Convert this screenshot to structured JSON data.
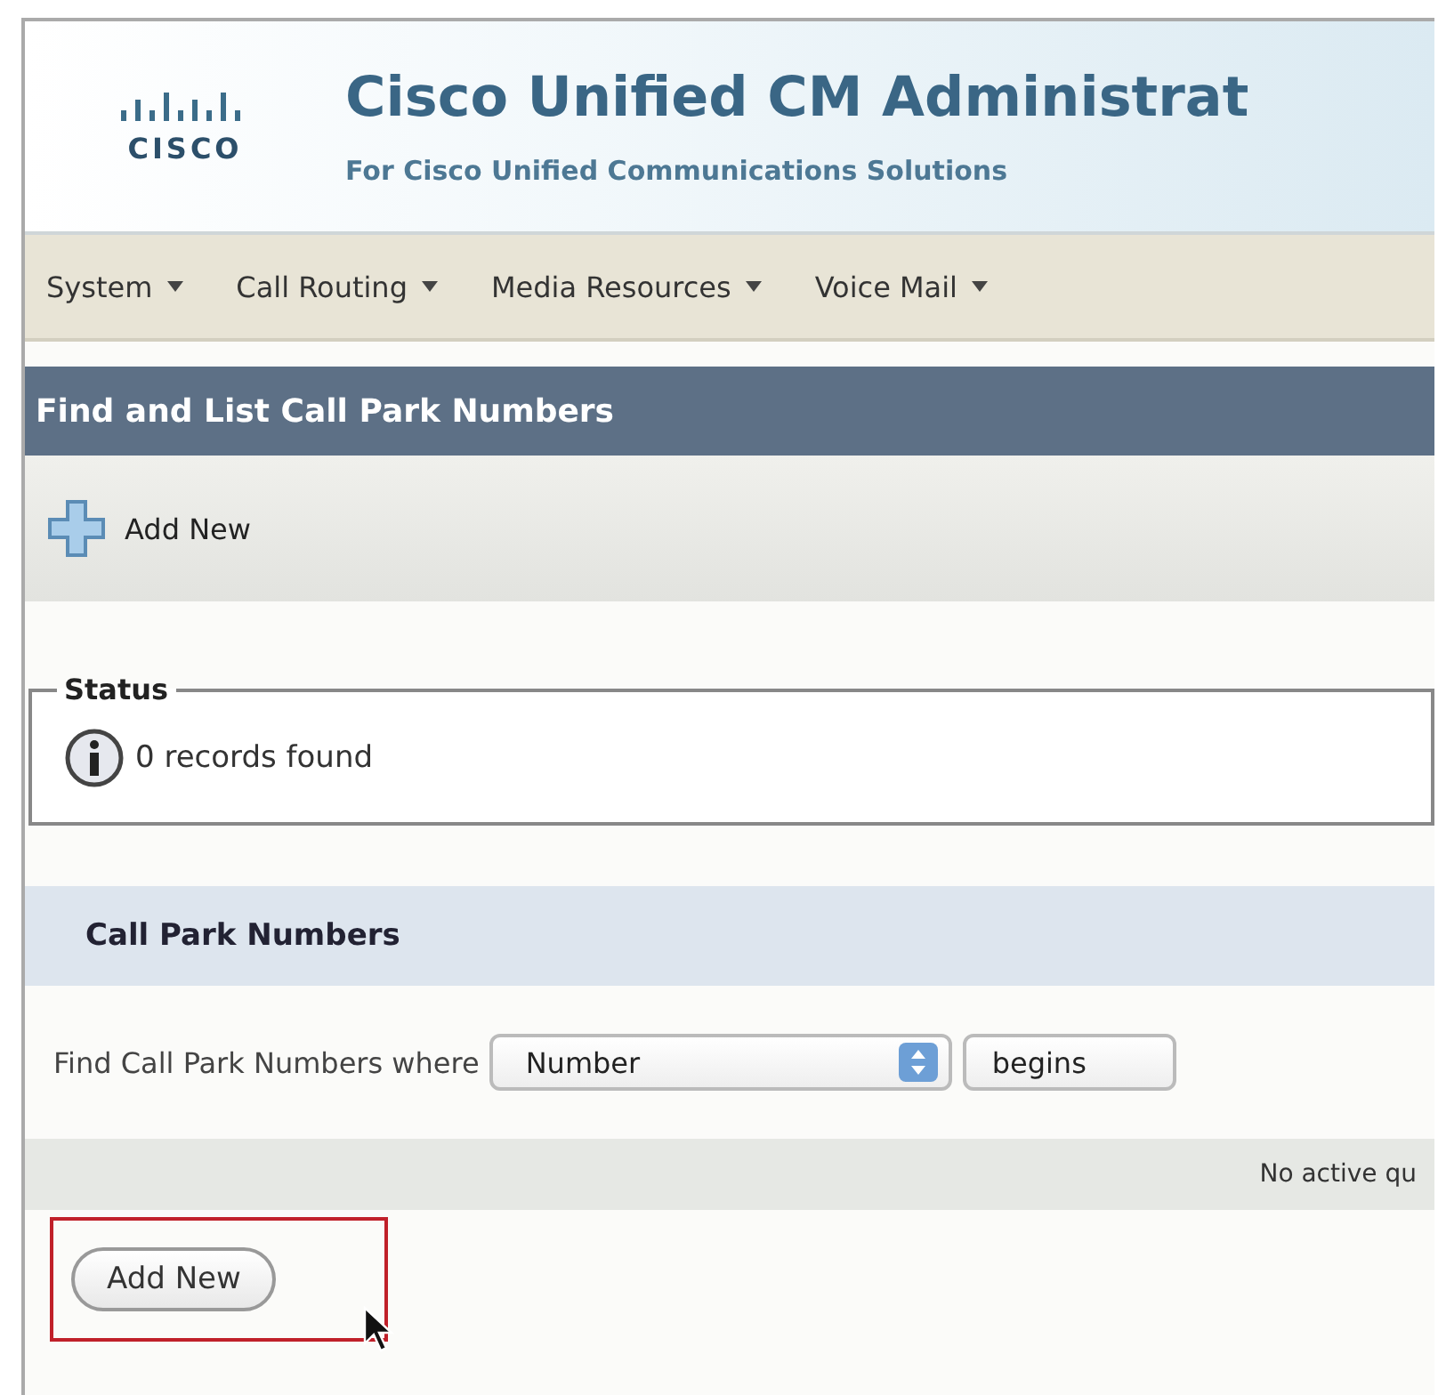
{
  "header": {
    "logo_text": "CISCO",
    "title": "Cisco Unified CM Administrat",
    "subtitle": "For Cisco Unified Communications Solutions"
  },
  "menu": [
    {
      "label": "System"
    },
    {
      "label": "Call Routing"
    },
    {
      "label": "Media Resources"
    },
    {
      "label": "Voice Mail"
    }
  ],
  "page_title": "Find and List Call Park Numbers",
  "toolbar": {
    "add_label": "Add New"
  },
  "status": {
    "legend": "Status",
    "message": "0 records found"
  },
  "section": {
    "title": "Call Park Numbers",
    "find_label": "Find Call Park Numbers where",
    "field_select": "Number",
    "operator_select": "begins",
    "query_note": "No active qu"
  },
  "add_button": {
    "label": "Add New",
    "highlighted": true
  }
}
